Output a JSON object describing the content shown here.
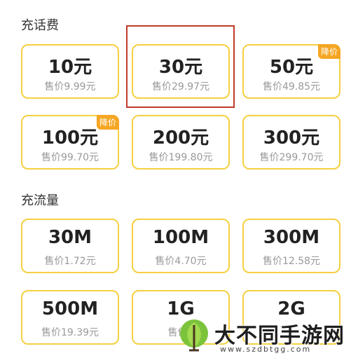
{
  "sections": {
    "topup": {
      "title": "充话费",
      "cards": [
        {
          "amount": "10元",
          "price": "售价9.99元"
        },
        {
          "amount": "30元",
          "price": "售价29.97元"
        },
        {
          "amount": "50元",
          "price": "售价49.85元",
          "badge": "降价"
        },
        {
          "amount": "100元",
          "price": "售价99.70元",
          "badge": "降价"
        },
        {
          "amount": "200元",
          "price": "售价199.80元"
        },
        {
          "amount": "300元",
          "price": "售价299.70元"
        }
      ]
    },
    "data": {
      "title": "充流量",
      "cards": [
        {
          "amount": "30M",
          "price": "售价1.72元"
        },
        {
          "amount": "100M",
          "price": "售价4.70元"
        },
        {
          "amount": "300M",
          "price": "售价12.58元"
        },
        {
          "amount": "500M",
          "price": "售价19.39元"
        },
        {
          "amount": "1G",
          "price": "售价2"
        },
        {
          "amount": "2G",
          "price": ""
        }
      ]
    }
  },
  "watermark": {
    "text": "大不同手游网",
    "url": "www.szdbtgg.com"
  },
  "colors": {
    "card_border": "#f5d042",
    "badge": "#f5a623",
    "highlight": "#c0392b"
  }
}
